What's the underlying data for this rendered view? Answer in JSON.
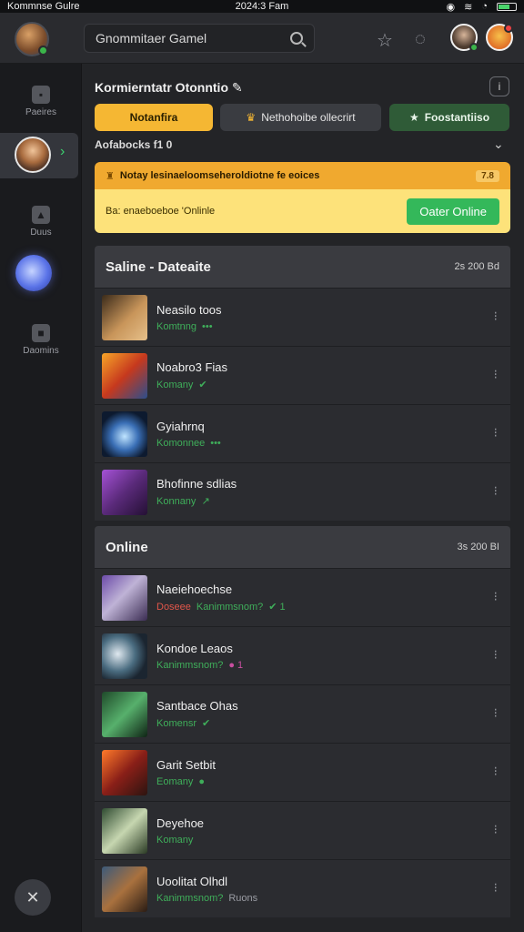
{
  "status_bar": {
    "left": "Kommnse Gulre",
    "center": "2024:3 Fam"
  },
  "topbar": {
    "search_text": "Gnommitaer Gamel",
    "icons": [
      "star-icon",
      "controller-icon"
    ]
  },
  "sidebar": {
    "items": [
      {
        "label": "Paeires",
        "icon": "user-icon"
      },
      {
        "label": "Duus",
        "icon": "person-icon"
      },
      {
        "label": "Daomins",
        "icon": "shield-icon"
      }
    ]
  },
  "main": {
    "title": "Kormierntatr Otonntio",
    "info_label": "i",
    "pills": [
      {
        "label": "Notanfira",
        "icon": ""
      },
      {
        "label": "Nethohoibe ollecrirt",
        "icon": "crown-icon"
      },
      {
        "label": "Foostantiiso",
        "icon": "star-icon"
      }
    ],
    "subheader": "Aofabocks f1 0",
    "banner": {
      "title": "Notay lesinaeloomseheroldiotne fe eoices",
      "tag": "7.8",
      "body": "Ba: enaeboeboe 'Onlinle",
      "button": "Oater Online"
    },
    "groups": [
      {
        "title": "Saline - Dateaite",
        "count": "2s 200 Bd",
        "rows": [
          {
            "name": "Neasilo toos",
            "sub": "Komtnng",
            "badge": "•••",
            "red": ""
          },
          {
            "name": "Noabro3 Fias",
            "sub": "Komany",
            "badge": "✔",
            "red": ""
          },
          {
            "name": "Gyiahrnq",
            "sub": "Komonnee",
            "badge": "•••",
            "red": ""
          },
          {
            "name": "Bhofinne sdlias",
            "sub": "Konnany",
            "badge": "↗",
            "red": ""
          }
        ]
      },
      {
        "title": "Online",
        "count": "3s 200 BI",
        "rows": [
          {
            "name": "Naeiehoechse",
            "sub": "Kanimmsnom?",
            "badge": "✔ 1",
            "red": "Doseee"
          },
          {
            "name": "Kondoe Leaos",
            "sub": "Kanimmsnom?",
            "badge": "● 1",
            "red": ""
          },
          {
            "name": "Santbace Ohas",
            "sub": "Komensr",
            "badge": "✔",
            "red": ""
          },
          {
            "name": "Garit Setbit",
            "sub": "Eomany",
            "badge": "●",
            "red": ""
          },
          {
            "name": "Deyehoe",
            "sub": "Komany",
            "badge": "",
            "red": ""
          },
          {
            "name": "Uoolitat Olhdl",
            "sub": "Kanimmsnom?",
            "badge": "Ruons",
            "red": ""
          }
        ]
      }
    ]
  }
}
